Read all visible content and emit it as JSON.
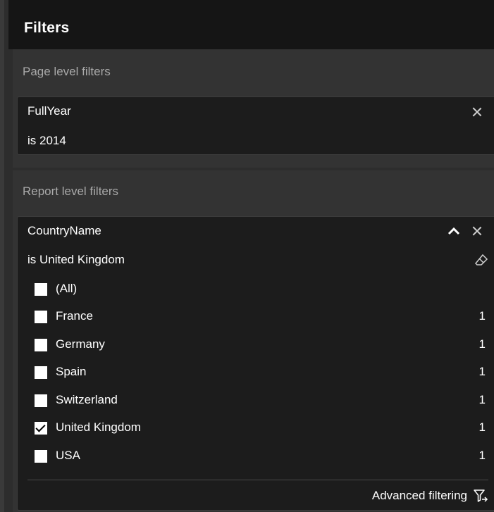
{
  "header": {
    "title": "Filters"
  },
  "page_level": {
    "label": "Page level filters",
    "card": {
      "field": "FullYear",
      "condition": "is 2014"
    }
  },
  "report_level": {
    "label": "Report level filters",
    "card": {
      "field": "CountryName",
      "condition": "is United Kingdom",
      "items": [
        {
          "label": "(All)",
          "count": "",
          "checked": false
        },
        {
          "label": "France",
          "count": "1",
          "checked": false
        },
        {
          "label": "Germany",
          "count": "1",
          "checked": false
        },
        {
          "label": "Spain",
          "count": "1",
          "checked": false
        },
        {
          "label": "Switzerland",
          "count": "1",
          "checked": false
        },
        {
          "label": "United Kingdom",
          "count": "1",
          "checked": true
        },
        {
          "label": "USA",
          "count": "1",
          "checked": false
        }
      ],
      "advanced_label": "Advanced filtering"
    }
  },
  "icons": {
    "close": "close-icon",
    "collapse": "chevron-up-icon",
    "clear": "eraser-icon",
    "advanced": "filter-arrow-icon"
  }
}
